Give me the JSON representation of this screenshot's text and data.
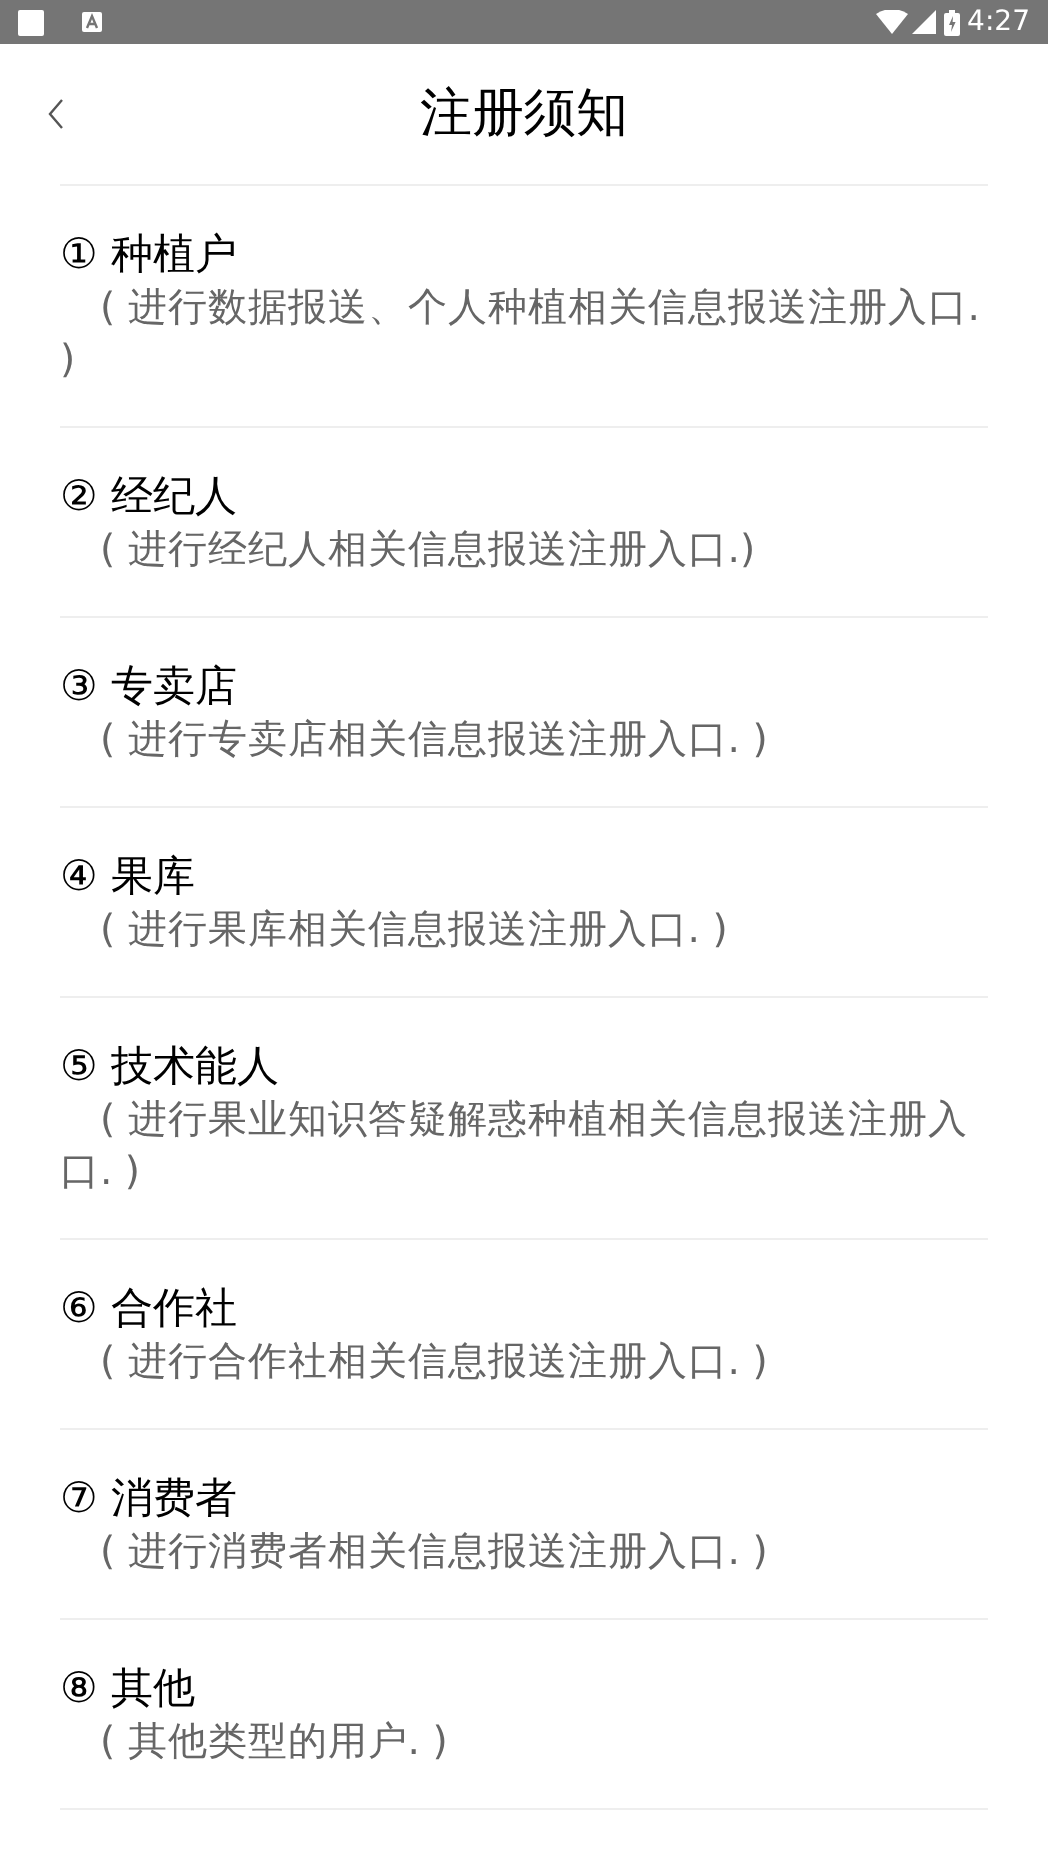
{
  "status_bar": {
    "time": "4:27"
  },
  "header": {
    "title": "注册须知"
  },
  "items": [
    {
      "number": "①",
      "title": "种植户",
      "description": "( 进行数据报送、个人种植相关信息报送注册入口. )"
    },
    {
      "number": "②",
      "title": "经纪人",
      "description": "( 进行经纪人相关信息报送注册入口.)"
    },
    {
      "number": "③",
      "title": "专卖店",
      "description": "( 进行专卖店相关信息报送注册入口. )"
    },
    {
      "number": "④",
      "title": "果库",
      "description": "( 进行果库相关信息报送注册入口. )"
    },
    {
      "number": "⑤",
      "title": "技术能人",
      "description": "( 进行果业知识答疑解惑种植相关信息报送注册入口. )"
    },
    {
      "number": "⑥",
      "title": "合作社",
      "description": "( 进行合作社相关信息报送注册入口. )"
    },
    {
      "number": "⑦",
      "title": "消费者",
      "description": "( 进行消费者相关信息报送注册入口. )"
    },
    {
      "number": "⑧",
      "title": "其他",
      "description": "( 其他类型的用户. )"
    }
  ]
}
